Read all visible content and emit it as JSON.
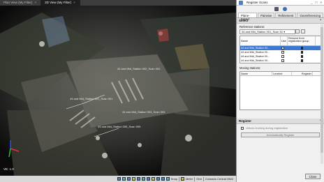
{
  "tabs": [
    {
      "label": "Plan View (My Filter)"
    },
    {
      "label": "3D View (My Filter)"
    }
  ],
  "viewport": {
    "labels": [
      "44 and Mid_Station 001_Scan 001",
      "44 and Mid_Station 002_Scan 002",
      "44 and Mid_Station 003_Scan 003",
      "44 and Mid_Station 005_Scan 005"
    ],
    "ve_label": "VE: 1.0"
  },
  "statusbar": {
    "snap": "Snap",
    "units": "Meter",
    "grid": "Grid",
    "coord_system": "Colorado Central 0502"
  },
  "panel": {
    "title": "Register Scans",
    "tabs": [
      "Plane-based",
      "Pairwise",
      "Refinement",
      "Georeferencing"
    ],
    "select_section": "Select",
    "reference_label": "Reference stations:",
    "reference_value": "44 and Mid_Station 001_Scan 01 ▾",
    "ref_columns": [
      "Name",
      "Use",
      "Remove from registration group"
    ],
    "ref_rows": [
      {
        "name": "44 and Mid_Station 00..."
      },
      {
        "name": "44 and Mid_Station 00..."
      },
      {
        "name": "44 and Mid_Station 00..."
      },
      {
        "name": "44 and Mid_Station 00..."
      }
    ],
    "moving_label": "Moving stations:",
    "moving_columns": [
      "Name",
      "Leveled",
      "Register"
    ],
    "register_section": "Register",
    "unlock_label": "Unlock leveling during registration",
    "auto_button": "Automatically Register",
    "close_button": "Close"
  }
}
